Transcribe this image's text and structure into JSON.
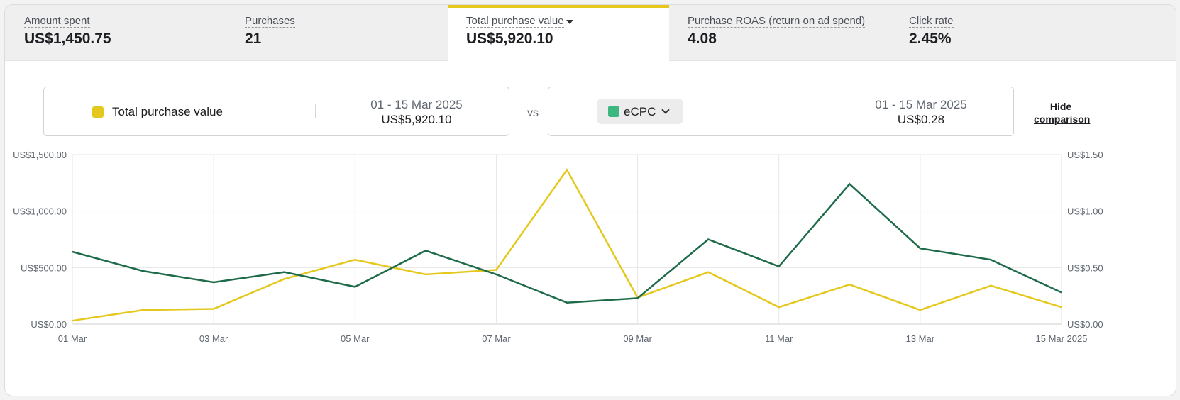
{
  "metrics": [
    {
      "label": "Amount spent",
      "value": "US$1,450.75"
    },
    {
      "label": "Purchases",
      "value": "21"
    },
    {
      "label": "Total purchase value",
      "value": "US$5,920.10"
    },
    {
      "label": "Purchase ROAS (return on ad spend)",
      "value": "4.08"
    },
    {
      "label": "Click rate",
      "value": "2.45%"
    }
  ],
  "comparison": {
    "primary": {
      "label": "Total purchase value",
      "date_range": "01 - 15 Mar 2025",
      "value": "US$5,920.10"
    },
    "vs_label": "vs",
    "secondary": {
      "label": "eCPC",
      "date_range": "01 - 15 Mar 2025",
      "value": "US$0.28"
    },
    "hide_label": "Hide comparison"
  },
  "colors": {
    "primary": "#e5c81e",
    "secondary": "#1e6b4a",
    "secondary_swatch": "#3cb77f",
    "active_tab": "#e5c81e"
  },
  "chart_data": {
    "type": "line",
    "x": [
      "01 Mar",
      "02 Mar",
      "03 Mar",
      "04 Mar",
      "05 Mar",
      "06 Mar",
      "07 Mar",
      "08 Mar",
      "09 Mar",
      "10 Mar",
      "11 Mar",
      "12 Mar",
      "13 Mar",
      "14 Mar",
      "15 Mar"
    ],
    "x_tick_labels": [
      "01 Mar",
      "03 Mar",
      "05 Mar",
      "07 Mar",
      "09 Mar",
      "11 Mar",
      "13 Mar",
      "15 Mar 2025"
    ],
    "series": [
      {
        "name": "Total purchase value",
        "axis": "left",
        "color": "#e5c81e",
        "values": [
          30,
          125,
          135,
          400,
          570,
          440,
          480,
          1365,
          235,
          460,
          150,
          350,
          125,
          340,
          150
        ]
      },
      {
        "name": "eCPC",
        "axis": "right",
        "color": "#1e6b4a",
        "values": [
          0.64,
          0.47,
          0.37,
          0.46,
          0.33,
          0.65,
          0.44,
          0.19,
          0.23,
          0.75,
          0.51,
          1.24,
          0.67,
          0.57,
          0.28
        ]
      }
    ],
    "y_left": {
      "lim": [
        0,
        1500
      ],
      "ticks": [
        0,
        500,
        1000,
        1500
      ],
      "tick_labels": [
        "US$0.00",
        "US$500.00",
        "US$1,000.00",
        "US$1,500.00"
      ]
    },
    "y_right": {
      "lim": [
        0,
        1.5
      ],
      "ticks": [
        0,
        0.5,
        1,
        1.5
      ],
      "tick_labels": [
        "US$0.00",
        "US$0.50",
        "US$1.00",
        "US$1.50"
      ]
    },
    "grid": true
  }
}
